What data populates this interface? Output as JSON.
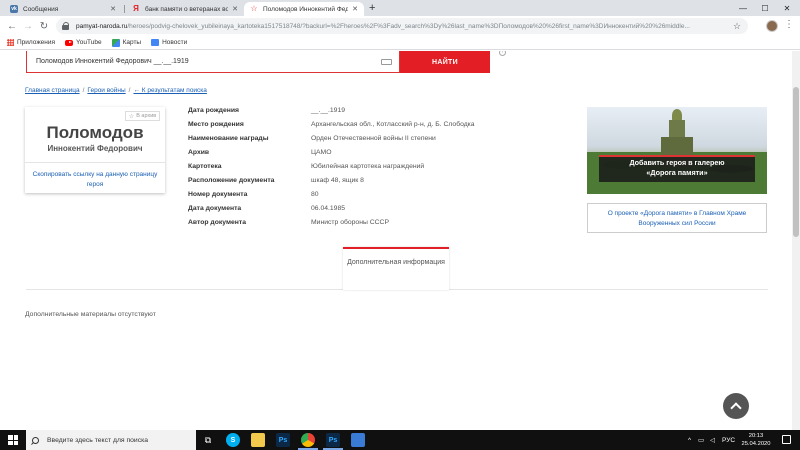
{
  "browser": {
    "tabs": [
      {
        "title": "Сообщения",
        "icon": "vk-icon"
      },
      {
        "title": "банк памяти о ветеранах вов - ",
        "icon": "yandex-icon"
      },
      {
        "title": "Поломодов Иннокентий Федо",
        "icon": "star-icon"
      }
    ],
    "new_tab_symbol": "+",
    "url_host": "pamyat-naroda.ru",
    "url_rest": "/heroes/podvig-chelovek_yubileinaya_kartoteka1517518748/?backurl=%2Fheroes%2F%3Fadv_search%3Dy%26last_name%3DПоломодов%20%26first_name%3DИннокентий%20%26middle...",
    "bookmarks": [
      "Приложения",
      "YouTube",
      "Карты",
      "Новости"
    ]
  },
  "search": {
    "query": "Поломодов Иннокентий Федорович __.__.1919",
    "button_label": "НАЙТИ",
    "help_symbol": "?"
  },
  "breadcrumb": {
    "home": "Главная страница",
    "heroes": "Герои войны",
    "separator": "/",
    "back": "← К результатам поиска"
  },
  "hero": {
    "badge": "В архив",
    "surname": "Поломодов",
    "given_names": "Иннокентий Федорович",
    "copy_link": "Скопировать ссылку на данную страницу героя"
  },
  "details": [
    {
      "label": "Дата рождения",
      "value": "__.__.1919"
    },
    {
      "label": "Место рождения",
      "value": "Архангельская обл., Котласский р-н, д. Б. Слободка"
    },
    {
      "label": "Наименование награды",
      "value": "Орден Отечественной войны II степени"
    },
    {
      "label": "Архив",
      "value": "ЦАМО"
    },
    {
      "label": "Картотека",
      "value": "Юбилейная картотека награждений"
    },
    {
      "label": "Расположение документа",
      "value": "шкаф 48, ящик 8"
    },
    {
      "label": "Номер документа",
      "value": "80"
    },
    {
      "label": "Дата документа",
      "value": "06.04.1985"
    },
    {
      "label": "Автор документа",
      "value": "Министр обороны СССР"
    }
  ],
  "promo": {
    "label_line1": "Добавить героя в галерею",
    "label_line2": "«Дорога памяти»",
    "about": "О проекте «Дорога памяти» в Главном Храме Вооруженных сил России"
  },
  "tabs": {
    "additional_info": "Дополнительная информация"
  },
  "content": {
    "no_materials": "Дополнительные материалы отсутствуют"
  },
  "taskbar": {
    "search_placeholder": "Введите здесь текст для поиска",
    "language": "РУС",
    "time": "20:13",
    "date": "25.04.2020"
  }
}
